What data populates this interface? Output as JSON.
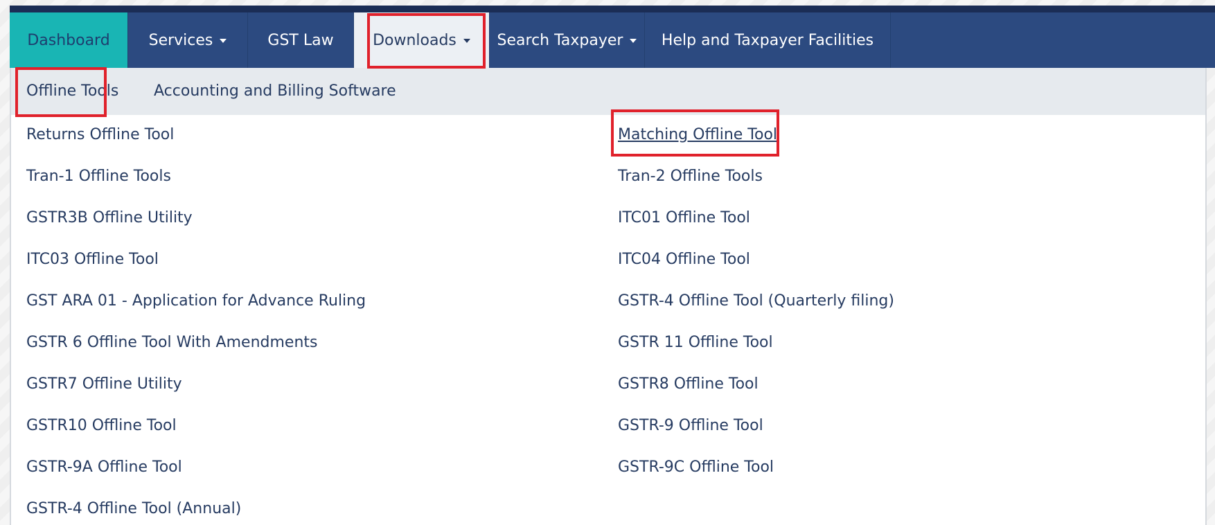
{
  "navbar": {
    "items": [
      {
        "label": "Dashboard"
      },
      {
        "label": "Services"
      },
      {
        "label": "GST Law"
      },
      {
        "label": "Downloads"
      },
      {
        "label": "Search Taxpayer"
      },
      {
        "label": "Help and Taxpayer Facilities"
      }
    ]
  },
  "downloads_menu": {
    "tabs": [
      {
        "label": "Offline Tools"
      },
      {
        "label": "Accounting and Billing Software"
      }
    ],
    "left_column": [
      "Returns Offline Tool",
      "Tran-1 Offline Tools",
      "GSTR3B Offline Utility",
      "ITC03 Offline Tool",
      "GST ARA 01 - Application for Advance Ruling",
      "GSTR 6 Offline Tool With Amendments",
      "GSTR7 Offline Utility",
      "GSTR10 Offline Tool",
      "GSTR-9A Offline Tool",
      "GSTR-4 Offline Tool (Annual)"
    ],
    "right_column": [
      "Matching Offline Tool",
      "Tran-2 Offline Tools",
      "ITC01 Offline Tool",
      "ITC04 Offline Tool",
      "GSTR-4 Offline Tool (Quarterly filing)",
      "GSTR 11 Offline Tool",
      "GSTR8 Offline Tool",
      "GSTR-9 Offline Tool",
      "GSTR-9C Offline Tool"
    ]
  },
  "colors": {
    "navbar_bg": "#2c4a80",
    "active_tab_bg": "#19b5b4",
    "dropdown_bg": "#ffffff",
    "highlight": "#e0212b",
    "link_text": "#263b61"
  },
  "icons": {
    "dropdown_caret": "chevron-down-icon"
  }
}
